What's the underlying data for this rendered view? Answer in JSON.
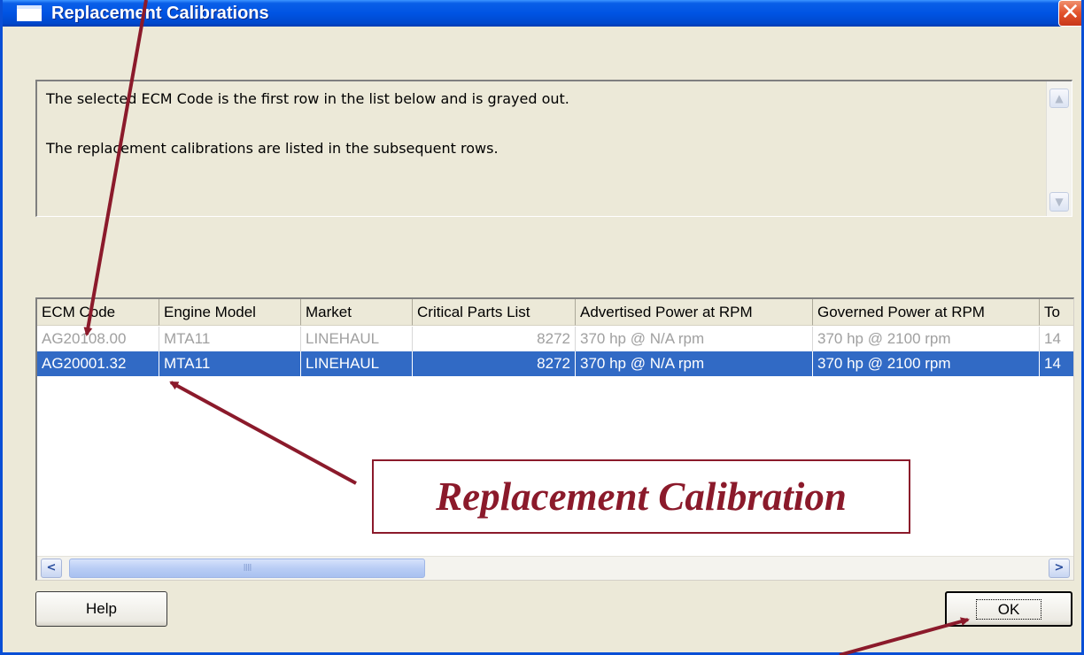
{
  "window": {
    "title": "Replacement Calibrations",
    "close_glyph": "✕"
  },
  "message": {
    "line1": "The selected ECM Code is the first row in the list below and is grayed out.",
    "line2": "The replacement calibrations are listed in the subsequent rows."
  },
  "grid": {
    "columns": [
      "ECM Code",
      "Engine Model",
      "Market",
      "Critical Parts List",
      "Advertised Power at RPM",
      "Governed Power at RPM",
      "To"
    ],
    "rows": [
      {
        "state": "grayed",
        "cells": [
          "AG20108.00",
          "MTA11",
          "LINEHAUL",
          "8272",
          "370 hp @ N/A rpm",
          "370 hp @ 2100 rpm",
          "14"
        ]
      },
      {
        "state": "selected",
        "cells": [
          "AG20001.32",
          "MTA11",
          "LINEHAUL",
          "8272",
          "370 hp @ N/A rpm",
          "370 hp @ 2100 rpm",
          "14"
        ]
      }
    ]
  },
  "scroll": {
    "thumb_grip": "IIII",
    "left_glyph": "<",
    "right_glyph": ">"
  },
  "buttons": {
    "help_label": "Help",
    "ok_label": "OK"
  },
  "annotation": {
    "callout_text": "Replacement Calibration",
    "color": "#8b1a2b"
  },
  "colors": {
    "titlebar": "#0054e3",
    "selection": "#316ac5",
    "dialog_bg": "#ece9d8"
  }
}
